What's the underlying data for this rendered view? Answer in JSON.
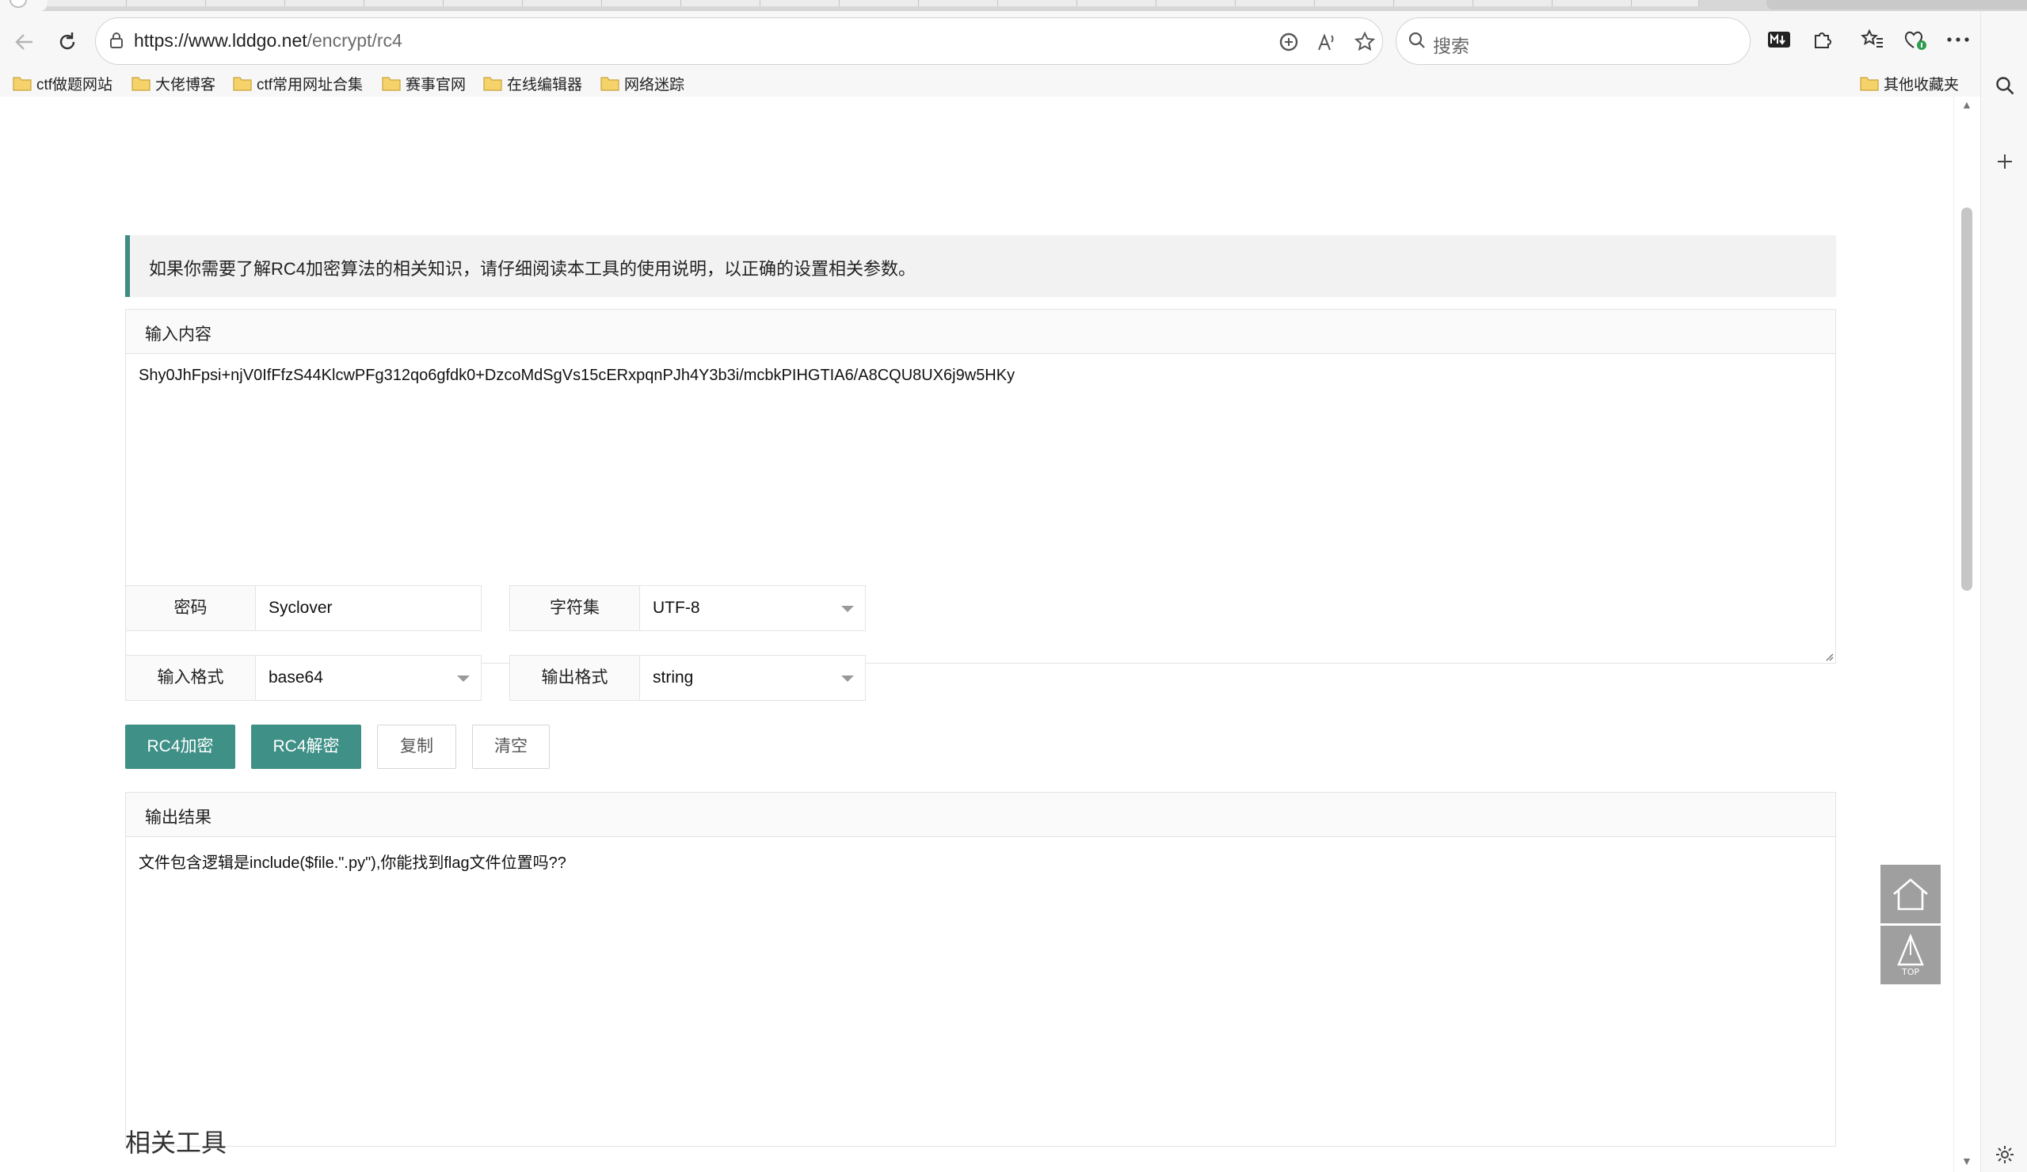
{
  "browser": {
    "url_host": "https://www.lddgo.net",
    "url_path": "/encrypt/rc4",
    "search_placeholder": "搜索",
    "bookmarks": [
      "ctf做题网站",
      "大佬博客",
      "ctf常用网址合集",
      "赛事官网",
      "在线编辑器",
      "网络迷踪"
    ],
    "other_bookmarks": "其他收藏夹"
  },
  "page": {
    "notice": "如果你需要了解RC4加密算法的相关知识，请仔细阅读本工具的使用说明，以正确的设置相关参数。",
    "input_label": "输入内容",
    "input_value": "Shy0JhFpsi+njV0IfFfzS44KlcwPFg312qo6gfdk0+DzcoMdSgVs15cERxpqnPJh4Y3b3i/mcbkPIHGTIA6/A8CQU8UX6j9w5HKy",
    "password_label": "密码",
    "password_value": "Syclover",
    "charset_label": "字符集",
    "charset_value": "UTF-8",
    "input_format_label": "输入格式",
    "input_format_value": "base64",
    "output_format_label": "输出格式",
    "output_format_value": "string",
    "buttons": {
      "encrypt": "RC4加密",
      "decrypt": "RC4解密",
      "copy": "复制",
      "clear": "清空"
    },
    "output_label": "输出结果",
    "output_value": "文件包含逻辑是include($file.\".py\"),你能找到flag文件位置吗??",
    "related_title": "相关工具",
    "top_label": "TOP"
  },
  "colors": {
    "accent": "#3f9187",
    "notice_border": "#3f8c83"
  }
}
